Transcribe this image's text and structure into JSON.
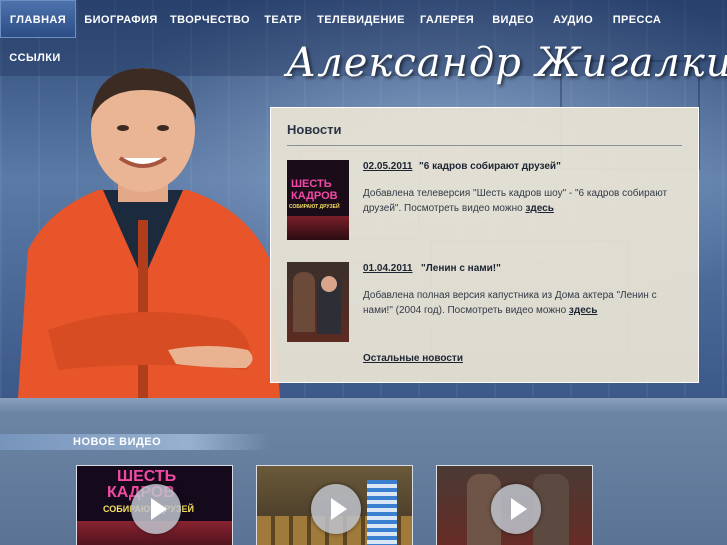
{
  "nav": {
    "items": [
      {
        "label": "ГЛАВНАЯ",
        "active": true
      },
      {
        "label": "БИОГРАФИЯ"
      },
      {
        "label": "ТВОРЧЕСТВО"
      },
      {
        "label": "ТЕАТР"
      },
      {
        "label": "ТЕЛЕВИДЕНИЕ"
      },
      {
        "label": "ГАЛЕРЕЯ"
      },
      {
        "label": "ВИДЕО"
      },
      {
        "label": "АУДИО"
      },
      {
        "label": "ПРЕССА"
      },
      {
        "label": "ССЫЛКИ"
      }
    ]
  },
  "site": {
    "title": "Александр Жигалкин"
  },
  "news": {
    "heading": "Новости",
    "items": [
      {
        "date": "02.05.2011",
        "title": "\"6 кадров собирают друзей\"",
        "body": "Добавлена телеверсия \"Шесть кадров шоу\" - \"6 кадров собирают друзей\". Посмотреть видео можно ",
        "link": "здесь",
        "thumb_text_1": "ШЕСТЬ",
        "thumb_text_2": "КАДРОВ",
        "thumb_text_3": "СОБИРАЮТ ДРУЗЕЙ"
      },
      {
        "date": "01.04.2011",
        "title": "\"Ленин с нами!\"",
        "body": "Добавлена полная версия капустника из Дома актера \"Ленин с нами!\" (2004 год). Посмотреть видео можно ",
        "link": "здесь"
      }
    ],
    "all_link": "Остальные новости"
  },
  "videos": {
    "section_title": "НОВОЕ ВИДЕО",
    "thumb1_text_1": "ШЕСТЬ",
    "thumb1_text_2": "КАДРОВ",
    "thumb1_text_3": "СОБИРАЮТ ДРУЗЕЙ"
  },
  "colors": {
    "nav_active": "#2c4d86",
    "panel": "#e8e2d4",
    "hero": "#3b5888",
    "accent_pink": "#e0338f"
  }
}
